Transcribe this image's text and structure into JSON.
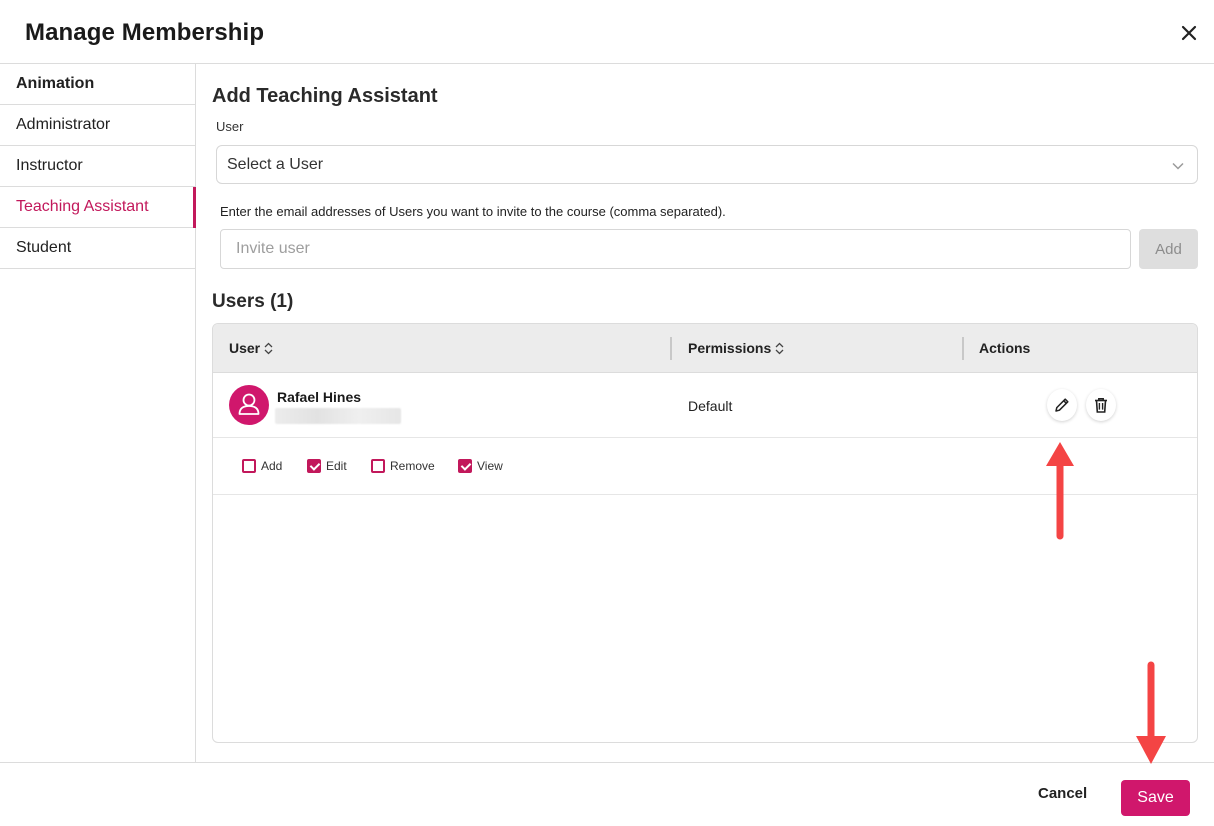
{
  "modal": {
    "title": "Manage Membership",
    "close_icon": "close-icon"
  },
  "sidebar": {
    "items": [
      {
        "label": "Animation"
      },
      {
        "label": "Administrator"
      },
      {
        "label": "Instructor"
      },
      {
        "label": "Teaching Assistant"
      },
      {
        "label": "Student"
      }
    ],
    "active_index": 3
  },
  "main": {
    "section_title": "Add Teaching Assistant",
    "user_field_label": "User",
    "user_select_value": "Select a User",
    "invite_hint": "Enter the email addresses of Users you want to invite to the course (comma separated).",
    "invite_placeholder": "Invite user",
    "add_label": "Add",
    "users_title": "Users (1)"
  },
  "table": {
    "columns": [
      "User",
      "Permissions",
      "Actions"
    ],
    "rows": [
      {
        "name": "Rafael Hines",
        "email": "",
        "permission": "Default",
        "actions": [
          "edit-pencil-icon",
          "trash-icon"
        ]
      }
    ],
    "permissions": [
      {
        "label": "Add",
        "checked": false
      },
      {
        "label": "Edit",
        "checked": true
      },
      {
        "label": "Remove",
        "checked": false
      },
      {
        "label": "View",
        "checked": true
      }
    ]
  },
  "footer": {
    "cancel_label": "Cancel",
    "save_label": "Save"
  },
  "colors": {
    "accent": "#c2185b",
    "save": "#d0176c",
    "annotation_arrow": "#f44444"
  }
}
